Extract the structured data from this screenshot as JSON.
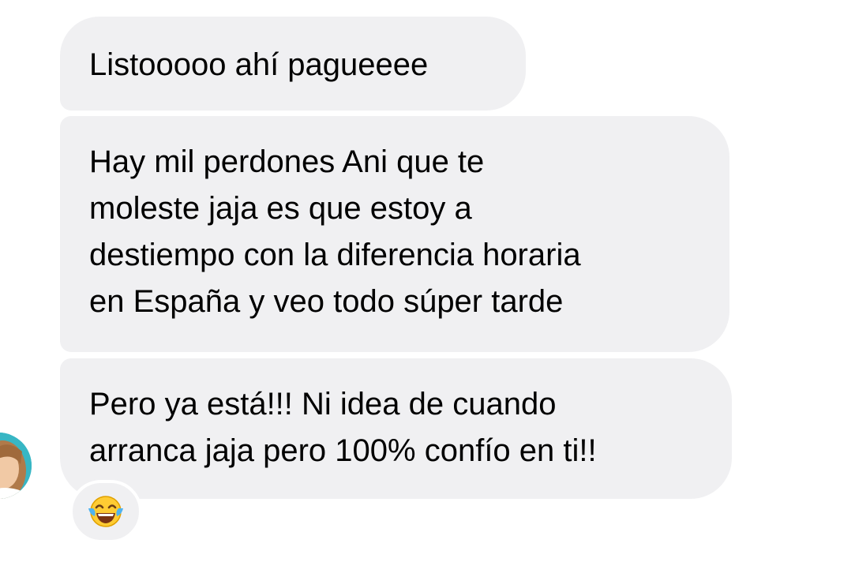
{
  "messages": [
    {
      "lines": [
        "Listooooo ahí pagueeee"
      ]
    },
    {
      "lines": [
        "Hay mil perdones Ani que te",
        "moleste jaja es que estoy a",
        "destiempo con la diferencia horaria",
        "en España y veo todo súper tarde"
      ]
    },
    {
      "lines": [
        "Pero ya está!!! Ni idea de cuando",
        "arranca jaja pero 100% confío en ti!!"
      ]
    }
  ],
  "reaction": {
    "icon": "face-with-tears-of-joy-icon"
  },
  "colors": {
    "bubble_background": "#f0f0f2",
    "avatar_background": "#37b6c4",
    "text": "#000000"
  }
}
